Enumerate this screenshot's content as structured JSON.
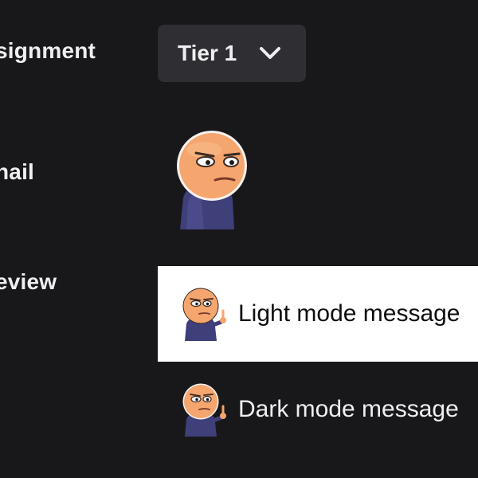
{
  "labels": {
    "assignment": "signment",
    "thumbnail": "nail",
    "preview": "eview"
  },
  "tier_select": {
    "value": "Tier 1",
    "icon": "chevron-down-icon"
  },
  "thumbnail": {
    "icon": "emote-thumbnail-icon"
  },
  "preview": {
    "light_text": "Light mode message",
    "dark_text": "Dark mode message"
  },
  "colors": {
    "background": "#18181b",
    "select_bg": "#2e2e33",
    "light_preview_bg": "#ffffff",
    "text": "#efeff1",
    "dark_text": "#0e0e10"
  }
}
